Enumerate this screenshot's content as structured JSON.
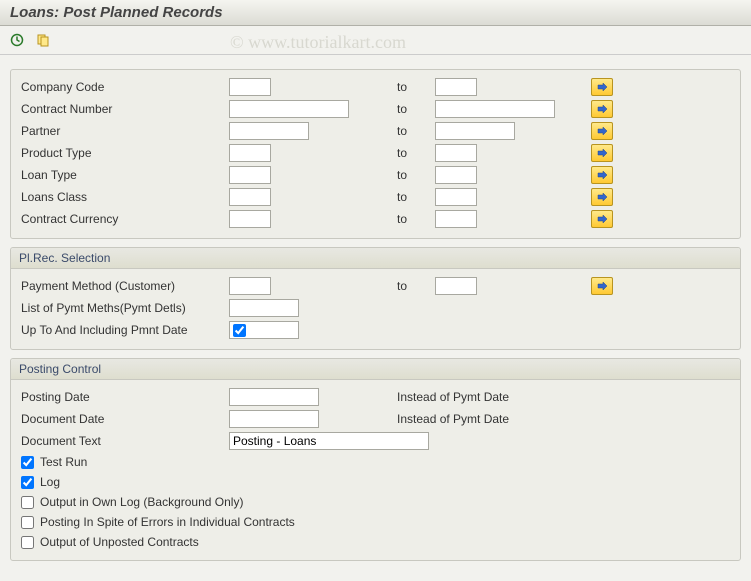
{
  "title": "Loans: Post Planned Records",
  "watermark": "© www.tutorialkart.com",
  "to_label": "to",
  "section1": {
    "rows": [
      {
        "label": "Company Code",
        "from": "",
        "to": "",
        "cls": "xs"
      },
      {
        "label": "Contract Number",
        "from": "",
        "to": "",
        "cls": "md"
      },
      {
        "label": "Partner",
        "from": "",
        "to": "",
        "cls": "sm"
      },
      {
        "label": "Product Type",
        "from": "",
        "to": "",
        "cls": "xs"
      },
      {
        "label": "Loan Type",
        "from": "",
        "to": "",
        "cls": "xs"
      },
      {
        "label": "Loans Class",
        "from": "",
        "to": "",
        "cls": "xs"
      },
      {
        "label": "Contract Currency",
        "from": "",
        "to": "",
        "cls": "xs"
      }
    ]
  },
  "section2": {
    "title": "Pl.Rec. Selection",
    "payment_method": {
      "label": "Payment Method (Customer)",
      "from": "",
      "to": ""
    },
    "list_pymt": {
      "label": "List of Pymt Meths(Pymt Detls)",
      "value": ""
    },
    "up_to_date": {
      "label": "Up To And Including Pmnt Date",
      "checked": true
    }
  },
  "section3": {
    "title": "Posting Control",
    "posting_date": {
      "label": "Posting Date",
      "value": "",
      "note": "Instead of Pymt Date"
    },
    "document_date": {
      "label": "Document Date",
      "value": "",
      "note": "Instead of Pymt Date"
    },
    "document_text": {
      "label": "Document Text",
      "value": "Posting - Loans"
    },
    "checks": [
      {
        "label": "Test Run",
        "checked": true
      },
      {
        "label": "Log",
        "checked": true
      },
      {
        "label": "Output in Own Log (Background Only)",
        "checked": false
      },
      {
        "label": "Posting In Spite of Errors in Individual Contracts",
        "checked": false
      },
      {
        "label": "Output of Unposted Contracts",
        "checked": false
      }
    ]
  }
}
